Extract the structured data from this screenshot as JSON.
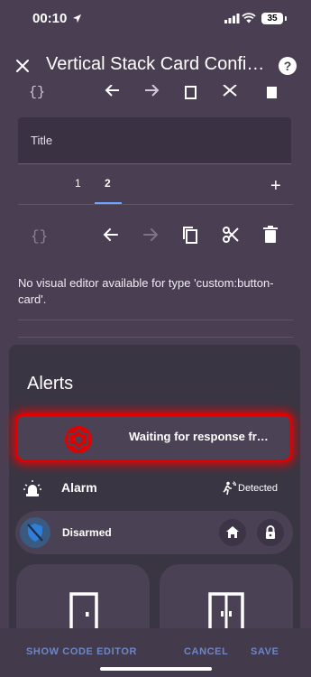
{
  "status_bar": {
    "time": "00:10",
    "battery": "35"
  },
  "header": {
    "title": "Vertical Stack Card Confi…",
    "help": "?"
  },
  "editor": {
    "title_placeholder": "Title",
    "tabs": [
      {
        "label": "1",
        "active": false
      },
      {
        "label": "2",
        "active": true
      }
    ],
    "add_label": "+",
    "message": "No visual editor available for type 'custom:button-card'."
  },
  "preview": {
    "alerts_title": "Alerts",
    "alert_text": "Waiting for response fr…",
    "alarm": {
      "label": "Alarm",
      "status": "Detected"
    },
    "disarmed": {
      "label": "Disarmed"
    }
  },
  "bottom": {
    "show_code_editor": "SHOW CODE EDITOR",
    "cancel": "CANCEL",
    "save": "SAVE"
  },
  "colors": {
    "background": "#4a3f52",
    "accent": "#6ea3ff",
    "alert_border": "#e00000",
    "button_text": "#6e86c9"
  },
  "icons": [
    "location-arrow-icon",
    "signal-icon",
    "wifi-icon",
    "battery-icon",
    "close-icon",
    "help-icon",
    "code-braces-icon",
    "arrow-left-icon",
    "arrow-right-icon",
    "copy-icon",
    "cut-icon",
    "delete-icon",
    "plus-icon",
    "alert-badge-icon",
    "alarm-light-icon",
    "motion-detected-icon",
    "shield-off-icon",
    "home-icon",
    "lock-icon",
    "door-icon",
    "double-door-icon"
  ]
}
